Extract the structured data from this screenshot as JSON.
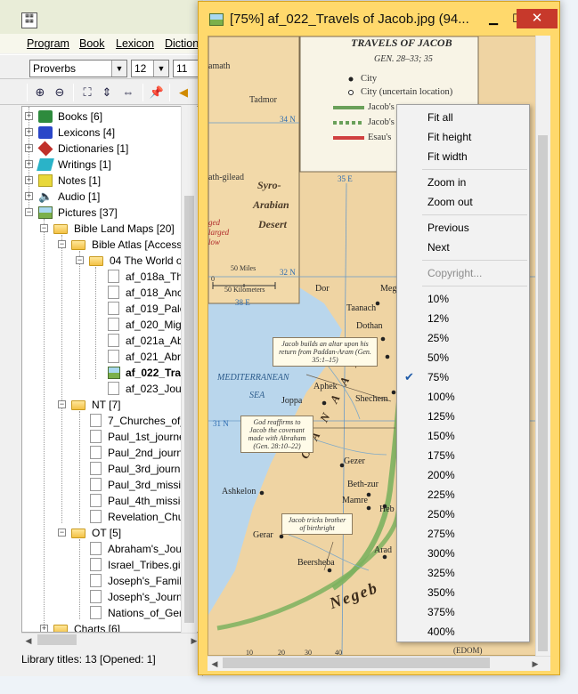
{
  "app": {
    "menu": [
      "Program",
      "Book",
      "Lexicon",
      "Diction"
    ],
    "book_select": "Proverbs",
    "font_size_1": "12",
    "font_size_2": "11",
    "status": "Library titles: 13  [Opened: 1]"
  },
  "tree": {
    "items": [
      {
        "label": "Books [6]",
        "icon": "books-icon",
        "color": "#2e8b3d"
      },
      {
        "label": "Lexicons [4]",
        "icon": "lexicon-icon",
        "color": "#2a46c8"
      },
      {
        "label": "Dictionaries [1]",
        "icon": "dictionary-icon",
        "color": "#c0302a"
      },
      {
        "label": "Writings [1]",
        "icon": "writings-icon",
        "color": "#2ab3c8"
      },
      {
        "label": "Notes [1]",
        "icon": "notes-icon",
        "color": "#e8d83a"
      },
      {
        "label": "Audio [1]",
        "icon": "audio-icon",
        "color": "#334"
      },
      {
        "label": "Pictures [37]",
        "icon": "pictures-icon",
        "color": "#7bb04a"
      },
      {
        "label": "Bible Land Maps [20]",
        "icon": "folder-icon"
      },
      {
        "label": "Bible Atlas [Access",
        "icon": "folder-icon"
      },
      {
        "label": "04 The World o",
        "icon": "folder-icon"
      },
      {
        "label": "af_018a_The",
        "icon": "file-icon"
      },
      {
        "label": "af_018_Anc",
        "icon": "file-icon"
      },
      {
        "label": "af_019_Pale",
        "icon": "file-icon"
      },
      {
        "label": "af_020_Mig",
        "icon": "file-icon"
      },
      {
        "label": "af_021a_Ab",
        "icon": "file-icon"
      },
      {
        "label": "af_021_Abra",
        "icon": "file-icon"
      },
      {
        "label": "af_022_Tra",
        "icon": "picture-file-icon"
      },
      {
        "label": "af_023_Jour",
        "icon": "file-icon"
      },
      {
        "label": "NT [7]",
        "icon": "folder-icon"
      },
      {
        "label": "7_Churches_of_",
        "icon": "file-icon"
      },
      {
        "label": "Paul_1st_journe",
        "icon": "file-icon"
      },
      {
        "label": "Paul_2nd_journ",
        "icon": "file-icon"
      },
      {
        "label": "Paul_3rd_journ",
        "icon": "file-icon"
      },
      {
        "label": "Paul_3rd_missic",
        "icon": "file-icon"
      },
      {
        "label": "Paul_4th_missic",
        "icon": "file-icon"
      },
      {
        "label": "Revelation_Chu",
        "icon": "file-icon"
      },
      {
        "label": "OT [5]",
        "icon": "folder-icon"
      },
      {
        "label": "Abraham's_Jou",
        "icon": "file-icon"
      },
      {
        "label": "Israel_Tribes.gif",
        "icon": "file-icon"
      },
      {
        "label": "Joseph's_Family",
        "icon": "file-icon"
      },
      {
        "label": "Joseph's_Journ",
        "icon": "file-icon"
      },
      {
        "label": "Nations_of_Ger",
        "icon": "file-icon"
      },
      {
        "label": "Charts [6]",
        "icon": "folder-icon"
      }
    ]
  },
  "image_window": {
    "title": "[75%] af_022_Travels of Jacob.jpg  (94..."
  },
  "map": {
    "heading": "TRAVELS OF JACOB",
    "subheading": "GEN. 28–33; 35",
    "legend": [
      "City",
      "City (uncertain location)",
      "Jacob's",
      "Jacob's",
      "Esau's"
    ],
    "places": [
      "Tadmor",
      "Syro-",
      "Arabian",
      "Desert",
      "amath",
      "ath-gilead",
      "ged",
      "larged",
      "low",
      "Dor",
      "Meg",
      "Taanach",
      "Dothan",
      "Shechem",
      "Aphek",
      "Joppa",
      "Gezer",
      "Beth-zur",
      "Mamre",
      "Heb",
      "Ashkelon",
      "Gerar",
      "Beersheba",
      "Arad",
      "Negeb",
      "C A N A A N",
      "MEDITERRANEAN",
      "SEA",
      "(EDOM)"
    ],
    "grid": [
      "34 N",
      "35 E",
      "32 N",
      "31 N",
      "38 E",
      "0",
      "50 Miles",
      "50 Kilometers",
      "10",
      "20",
      "30",
      "40"
    ],
    "callouts": [
      "Jacob builds an altar upon his return from Paddan-Aram (Gen. 35:1–15)",
      "God reaffirms to Jacob the covenant made with Abraham (Gen. 28:10–22)",
      "Jacob tricks brother of birthright"
    ]
  },
  "context_menu": {
    "view": [
      "Fit all",
      "Fit height",
      "Fit width"
    ],
    "zoom": [
      "Zoom in",
      "Zoom out"
    ],
    "nav": [
      "Previous",
      "Next"
    ],
    "copyright": "Copyright...",
    "levels": [
      "10%",
      "12%",
      "25%",
      "50%",
      "75%",
      "100%",
      "125%",
      "150%",
      "175%",
      "200%",
      "225%",
      "250%",
      "275%",
      "300%",
      "325%",
      "350%",
      "375%",
      "400%"
    ],
    "checked": "75%"
  }
}
